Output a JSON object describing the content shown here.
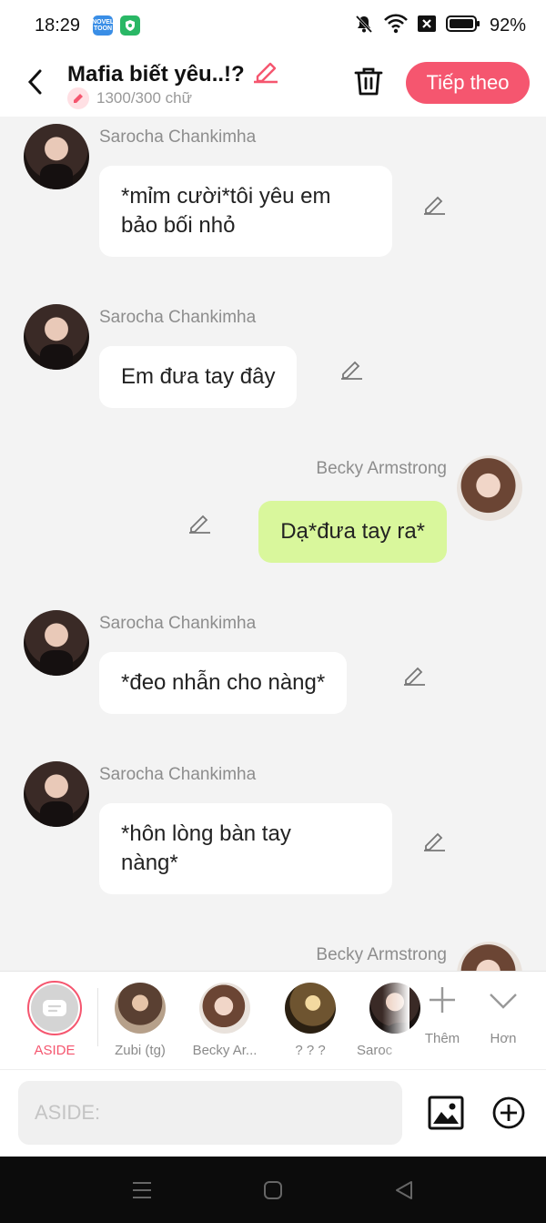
{
  "status": {
    "time": "18:29",
    "battery": "92%",
    "app1_text": "NOVEL TOON"
  },
  "header": {
    "title": "Mafia biết yêu..!?",
    "word_count": "1300/300 chữ",
    "next_label": "Tiếp theo"
  },
  "messages": [
    {
      "sender": "Sarocha Chankimha",
      "line1": "*mỉm cười*tôi yêu em",
      "line2": "bảo bối nhỏ"
    },
    {
      "sender": "Sarocha Chankimha",
      "text": "Em đưa tay đây"
    },
    {
      "sender": "Becky Armstrong",
      "text": "Dạ*đưa tay ra*"
    },
    {
      "sender": "Sarocha Chankimha",
      "text": "*đeo nhẫn cho nàng*"
    },
    {
      "sender": "Sarocha Chankimha",
      "line1": "*hôn lòng bàn tay",
      "line2": "nàng*"
    },
    {
      "sender": "Becky Armstrong"
    }
  ],
  "characters": [
    {
      "label": "ASIDE"
    },
    {
      "label": "Zubi (tg)"
    },
    {
      "label": "Becky Ar..."
    },
    {
      "label": "? ? ?"
    },
    {
      "label": "Saroc"
    }
  ],
  "more_add": "Thêm",
  "more_more": "Hơn",
  "input": {
    "placeholder": "ASIDE:"
  },
  "colors": {
    "accent": "#f5566f",
    "my_bubble": "#d9f79c"
  }
}
